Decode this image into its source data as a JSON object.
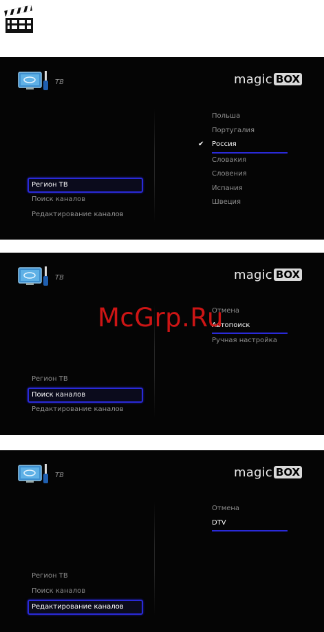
{
  "icons": {
    "clapperboard": "clapperboard-icon",
    "tv_setup": "tv-setup-icon"
  },
  "watermark": "McGrp.Ru",
  "panels": [
    {
      "tv_label": "ТВ",
      "brand": {
        "magic": "magic",
        "box": "BOX"
      },
      "left_menu": [
        "Регион ТВ",
        "Поиск каналов",
        "Редактирование каналов"
      ],
      "left_selected": 0,
      "right_list": [
        "Польша",
        "Португалия",
        "Россия",
        "Словакия",
        "Словения",
        "Испания",
        "Швеция"
      ],
      "right_selected": 2,
      "right_checked": 2
    },
    {
      "tv_label": "ТВ",
      "brand": {
        "magic": "magic",
        "box": "BOX"
      },
      "left_menu": [
        "Регион ТВ",
        "Поиск каналов",
        "Редактирование каналов"
      ],
      "left_selected": 1,
      "right_list": [
        "Отмена",
        "Автопоиск",
        "Ручная настройка"
      ],
      "right_selected": 1
    },
    {
      "tv_label": "ТВ",
      "brand": {
        "magic": "magic",
        "box": "BOX"
      },
      "left_menu": [
        "Регион ТВ",
        "Поиск каналов",
        "Редактирование каналов"
      ],
      "left_selected": 2,
      "right_list": [
        "Отмена",
        "DTV"
      ],
      "right_selected": 1
    }
  ],
  "colors": {
    "background": "#050505",
    "selection_border": "#2a2ad8",
    "watermark": "#d81616"
  }
}
